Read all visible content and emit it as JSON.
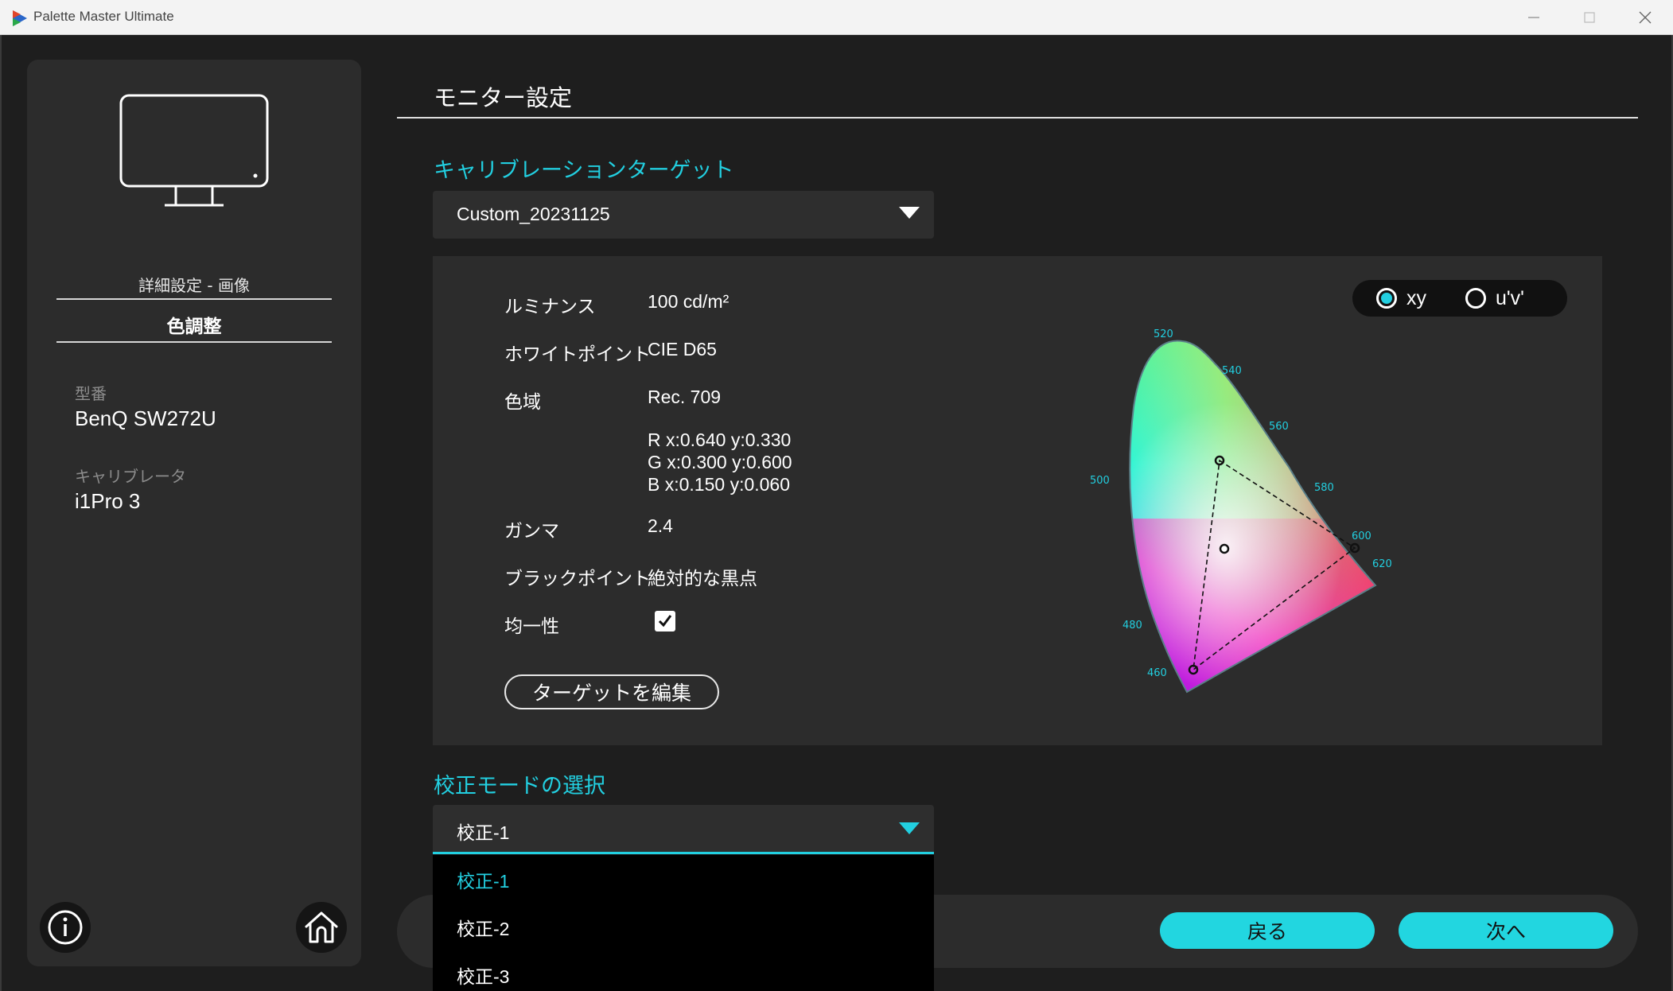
{
  "window": {
    "title": "Palette Master Ultimate"
  },
  "sidebar": {
    "subtitle": "詳細設定 - 画像",
    "section": "色調整",
    "model_label": "型番",
    "model_value": "BenQ SW272U",
    "calibrator_label": "キャリブレータ",
    "calibrator_value": "i1Pro 3"
  },
  "page": {
    "title": "モニター設定"
  },
  "target": {
    "section_title": "キャリブレーションターゲット",
    "selected": "Custom_20231125",
    "luminance_label": "ルミナンス",
    "luminance_value": "100 cd/m²",
    "white_point_label": "ホワイトポイント",
    "white_point_value": "CIE D65",
    "gamut_label": "色域",
    "gamut_value": "Rec. 709",
    "primary_r": "R x:0.640 y:0.330",
    "primary_g": "G x:0.300 y:0.600",
    "primary_b": "B x:0.150 y:0.060",
    "gamma_label": "ガンマ",
    "gamma_value": "2.4",
    "black_point_label": "ブラックポイント",
    "black_point_value": "絶対的な黒点",
    "uniformity_label": "均一性",
    "uniformity_checked": true,
    "edit_button": "ターゲットを編集"
  },
  "diagram": {
    "toggle_xy": "xy",
    "toggle_uv": "u'v'",
    "selected": "xy",
    "wavelengths": [
      "520",
      "540",
      "560",
      "580",
      "600",
      "620",
      "500",
      "480",
      "460"
    ]
  },
  "mode": {
    "section_title": "校正モードの選択",
    "selected": "校正-1",
    "options": [
      "校正-1",
      "校正-2",
      "校正-3"
    ]
  },
  "buttons": {
    "back": "戻る",
    "next": "次へ"
  },
  "colors": {
    "accent": "#22cfe0",
    "background": "#1e1e1e",
    "panel": "#2c2c2c"
  }
}
